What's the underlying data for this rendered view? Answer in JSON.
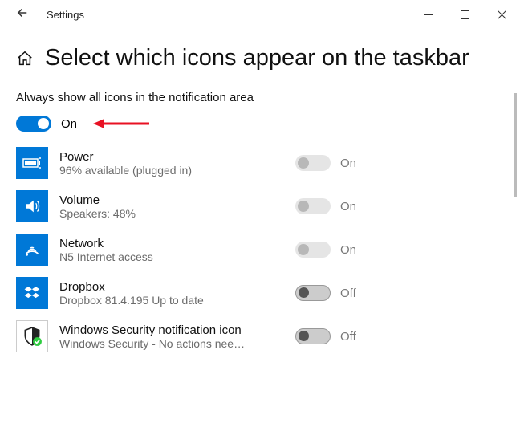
{
  "window": {
    "title": "Settings"
  },
  "page": {
    "heading": "Select which icons appear on the taskbar",
    "section_label": "Always show all icons in the notification area",
    "master_toggle_state": "On"
  },
  "items": [
    {
      "title": "Power",
      "sub": "96% available (plugged in)",
      "state": "On"
    },
    {
      "title": "Volume",
      "sub": "Speakers: 48%",
      "state": "On"
    },
    {
      "title": "Network",
      "sub": "N5 Internet access",
      "state": "On"
    },
    {
      "title": "Dropbox",
      "sub": "Dropbox 81.4.195 Up to date",
      "state": "Off"
    },
    {
      "title": "Windows Security notification icon",
      "sub": "Windows Security - No actions nee…",
      "state": "Off"
    }
  ]
}
